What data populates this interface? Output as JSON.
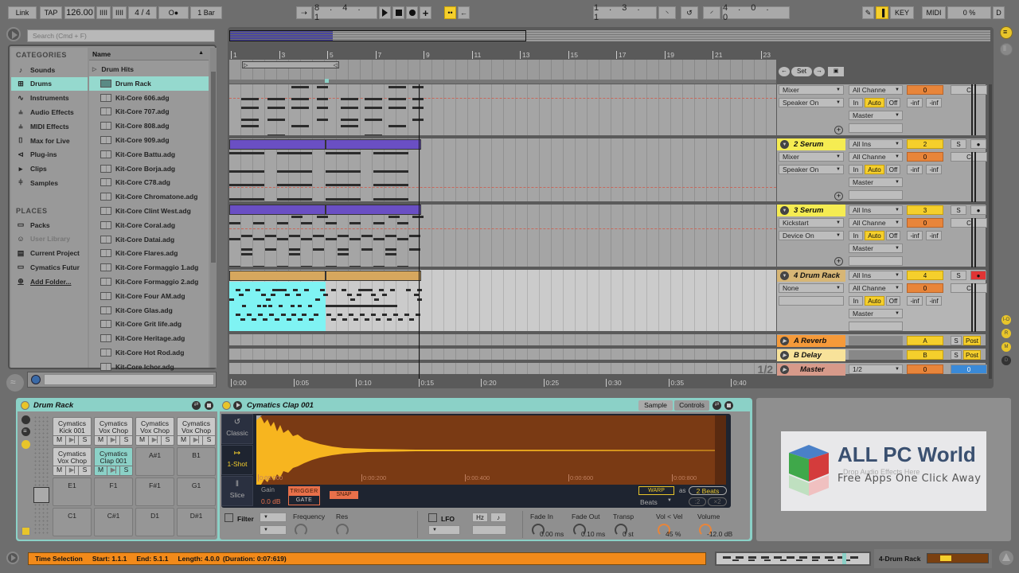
{
  "transport": {
    "link": "Link",
    "tap": "TAP",
    "tempo": "126.00",
    "nudge_down": "IIII",
    "nudge_up": "IIII",
    "time_signature": "4 / 4",
    "metronome": "O●",
    "quantize": "1 Bar",
    "follow": "⇢",
    "position": "8 . 4 . 1",
    "loop_start": "1 . 3 . 1",
    "loop_length": "4 . 0 . 0",
    "key_label": "KEY",
    "midi_label": "MIDI",
    "cpu": "0 %",
    "d_label": "D"
  },
  "browser": {
    "search_placeholder": "Search (Cmd + F)",
    "categories_title": "CATEGORIES",
    "categories": [
      {
        "label": "Sounds",
        "icon": "♪",
        "selected": false
      },
      {
        "label": "Drums",
        "icon": "⊞",
        "selected": true
      },
      {
        "label": "Instruments",
        "icon": "∿",
        "selected": false
      },
      {
        "label": "Audio Effects",
        "icon": "⫨",
        "selected": false
      },
      {
        "label": "MIDI Effects",
        "icon": "⫨",
        "selected": false
      },
      {
        "label": "Max for Live",
        "icon": "⌷",
        "selected": false
      },
      {
        "label": "Plug-ins",
        "icon": "⊲",
        "selected": false
      },
      {
        "label": "Clips",
        "icon": "▸",
        "selected": false
      },
      {
        "label": "Samples",
        "icon": "⫩",
        "selected": false
      }
    ],
    "places_title": "PLACES",
    "places": [
      {
        "label": "Packs",
        "icon": "▭"
      },
      {
        "label": "User Library",
        "icon": "☺"
      },
      {
        "label": "Current Project",
        "icon": "▤"
      },
      {
        "label": "Cymatics Futur",
        "icon": "▭"
      },
      {
        "label": "Add Folder...",
        "icon": "⊕"
      }
    ],
    "column_header": "Name",
    "folder": "Drum Hits",
    "files": [
      "Drum Rack",
      "Kit-Core 606.adg",
      "Kit-Core 707.adg",
      "Kit-Core 808.adg",
      "Kit-Core 909.adg",
      "Kit-Core Battu.adg",
      "Kit-Core Borja.adg",
      "Kit-Core C78.adg",
      "Kit-Core Chromatone.adg",
      "Kit-Core Clint West.adg",
      "Kit-Core Coral.adg",
      "Kit-Core Datai.adg",
      "Kit-Core Flares.adg",
      "Kit-Core Formaggio 1.adg",
      "Kit-Core Formaggio 2.adg",
      "Kit-Core Four AM.adg",
      "Kit-Core Glas.adg",
      "Kit-Core Grit life.adg",
      "Kit-Core Heritage.adg",
      "Kit-Core Hot Rod.adg",
      "Kit-Core Ichor.adg"
    ]
  },
  "arrangement": {
    "bar_ruler": [
      "1",
      "3",
      "5",
      "7",
      "9",
      "11",
      "13",
      "15",
      "17",
      "19",
      "21",
      "23"
    ],
    "time_ruler": [
      "0:00",
      "0:05",
      "0:10",
      "0:15",
      "0:20",
      "0:25",
      "0:30",
      "0:35",
      "0:40"
    ],
    "zoom_fraction": "1/2",
    "set_label": "Set"
  },
  "tracks": [
    {
      "name": "",
      "color": "#a5a5a5",
      "number": "",
      "input": "",
      "input2": "Mixer",
      "channel": "All Channe",
      "mode": "Speaker On",
      "output": "Master",
      "vol": "0",
      "pan": "C",
      "peak_l": "-inf",
      "peak_r": "-inf",
      "in": "In",
      "auto": "Auto",
      "off": "Off"
    },
    {
      "name": "2 Serum",
      "color": "#f5ec52",
      "number": "2",
      "input": "All Ins",
      "input2": "Mixer",
      "channel": "All Channe",
      "mode": "Speaker On",
      "output": "Master",
      "vol": "0",
      "pan": "C",
      "peak_l": "-inf",
      "peak_r": "-inf",
      "in": "In",
      "auto": "Auto",
      "off": "Off",
      "solo": "S"
    },
    {
      "name": "3 Serum",
      "color": "#f5ec52",
      "number": "3",
      "input": "All Ins",
      "input2": "Kickstart",
      "channel": "All Channe",
      "mode": "Device On",
      "output": "Master",
      "vol": "0",
      "pan": "C",
      "peak_l": "-inf",
      "peak_r": "-inf",
      "in": "In",
      "auto": "Auto",
      "off": "Off",
      "solo": "S"
    },
    {
      "name": "4 Drum Rack",
      "color": "#d7b676",
      "number": "4",
      "input": "All Ins",
      "input2": "None",
      "channel": "All Channe",
      "mode": "",
      "output": "Master",
      "vol": "0",
      "pan": "C",
      "peak_l": "-inf",
      "peak_r": "-inf",
      "in": "In",
      "auto": "Auto",
      "off": "Off",
      "solo": "S"
    }
  ],
  "returns": [
    {
      "name": "A Reverb",
      "color": "#f59a3a",
      "letter": "A",
      "solo": "S",
      "post": "Post"
    },
    {
      "name": "B Delay",
      "color": "#f8e29a",
      "letter": "B",
      "solo": "S",
      "post": "Post"
    }
  ],
  "master": {
    "name": "Master",
    "color": "#d79a8a",
    "output": "1/2",
    "vol": "0",
    "pan": "0"
  },
  "side_toggles": [
    "I-O",
    "R",
    "M",
    "D"
  ],
  "drum_rack": {
    "title": "Drum Rack",
    "pads": [
      {
        "label": "Cymatics Kick 001",
        "filled": true,
        "selected": false
      },
      {
        "label": "Cymatics Vox Chop",
        "filled": true,
        "selected": false
      },
      {
        "label": "Cymatics Vox Chop",
        "filled": true,
        "selected": false
      },
      {
        "label": "Cymatics Vox Chop",
        "filled": true,
        "selected": false
      },
      {
        "label": "Cymatics Vox Chop",
        "filled": true,
        "selected": false
      },
      {
        "label": "Cymatics Clap 001",
        "filled": true,
        "selected": true
      },
      {
        "label": "A#1",
        "filled": false
      },
      {
        "label": "B1",
        "filled": false
      },
      {
        "label": "E1",
        "filled": false
      },
      {
        "label": "F1",
        "filled": false
      },
      {
        "label": "F#1",
        "filled": false
      },
      {
        "label": "G1",
        "filled": false
      },
      {
        "label": "C1",
        "filled": false
      },
      {
        "label": "C#1",
        "filled": false
      },
      {
        "label": "D1",
        "filled": false
      },
      {
        "label": "D#1",
        "filled": false
      }
    ],
    "pad_m": "M",
    "pad_s": "S"
  },
  "simpler": {
    "title": "Cymatics Clap 001",
    "tab_sample": "Sample",
    "tab_controls": "Controls",
    "modes": [
      "Classic",
      "1-Shot",
      "Slice"
    ],
    "active_mode": "1-Shot",
    "time_marks": [
      "0:00:000",
      "0:00:200",
      "0:00:400",
      "0:00:600",
      "0:00:800"
    ],
    "gain_label": "Gain",
    "gain_value": "0.0 dB",
    "trigger": "TRIGGER",
    "gate": "GATE",
    "snap": "SNAP",
    "warp": "WARP",
    "as_label": "as",
    "beats_value": "2 Beats",
    "warp_mode": "Beats",
    "half": ":2",
    "double": "×2",
    "filter_label": "Filter",
    "frequency_label": "Frequency",
    "res_label": "Res",
    "lfo_label": "LFO",
    "hz_label": "Hz",
    "sync_label": "♪",
    "knobs": [
      {
        "label": "Fade In",
        "value": "0.00 ms"
      },
      {
        "label": "Fade Out",
        "value": "0.10 ms"
      },
      {
        "label": "Transp",
        "value": "0 st"
      },
      {
        "label": "Vol < Vel",
        "value": "45 %"
      },
      {
        "label": "Volume",
        "value": "-12.0 dB"
      }
    ]
  },
  "drop_zone": "Drop Audio Effects Here",
  "watermark": {
    "title": "ALL PC World",
    "subtitle": "Free Apps One Click Away"
  },
  "status": {
    "label": "Time Selection",
    "start": "Start: 1.1.1",
    "end": "End: 5.1.1",
    "length": "Length: 4.0.0",
    "duration": "(Duration: 0:07:619)",
    "track_name": "4-Drum Rack"
  }
}
